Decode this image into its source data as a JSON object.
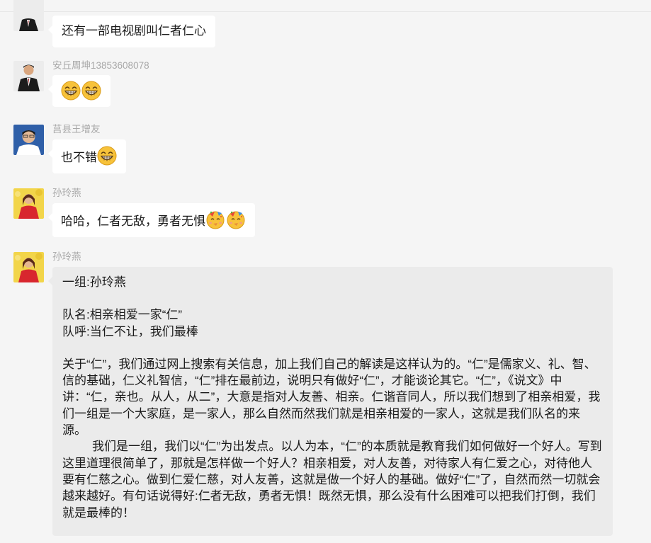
{
  "messages": [
    {
      "id": "m1",
      "text": "还有一部电视剧叫仁者仁心"
    },
    {
      "id": "m2",
      "sender": "安丘周坤13853608078",
      "emoji": [
        "grinning-emoji",
        "grinning-emoji"
      ]
    },
    {
      "id": "m3",
      "sender": "莒县王增友",
      "text": "也不错",
      "emoji": [
        "grinning-emoji"
      ]
    },
    {
      "id": "m4",
      "sender": "孙玲燕",
      "text": "哈哈，仁者无敌，勇者无惧",
      "emoji": [
        "party-emoji",
        "party-emoji"
      ]
    },
    {
      "id": "m5",
      "sender": "孙玲燕",
      "lines": {
        "group": "一组:孙玲燕",
        "team_name": "队名:相亲相爱一家“仁”",
        "team_slogan": "队呼:当仁不让，我们最棒",
        "para1": "关于“仁”，我们通过网上搜索有关信息，加上我们自己的解读是这样认为的。“仁”是儒家义、礼、智、信的基础，仁义礼智信，“仁”排在最前边，说明只有做好“仁”，才能谈论其它。“仁”，《说文》中讲：“仁，亲也。从人，从二”，大意是指对人友善、相亲。仁谐音同人，所以我们想到了相亲相爱，我们一组是一个大家庭，是一家人，那么自然而然我们就是相亲相爱的一家人，这就是我们队名的来源。",
        "para2": "我们是一组，我们以“仁”为出发点。以人为本，“仁”的本质就是教育我们如何做好一个好人。写到这里道理很简单了，那就是怎样做一个好人？相亲相爱，对人友善，对待家人有仁爱之心，对待他人要有仁慈之心。做到仁爱仁慈，对人友善，这就是做一个好人的基础。做好“仁”了，自然而然一切就会越来越好。有句话说得好:仁者无敌，勇者无惧！既然无惧，那么没有什么困难可以把我们打倒，我们就是最棒的！"
      }
    }
  ],
  "colors": {
    "background": "#f5f5f5",
    "bubble": "#ffffff",
    "bubble_long": "#ebebeb",
    "sender_name": "#a8a8a8",
    "text": "#1a1a1a"
  }
}
